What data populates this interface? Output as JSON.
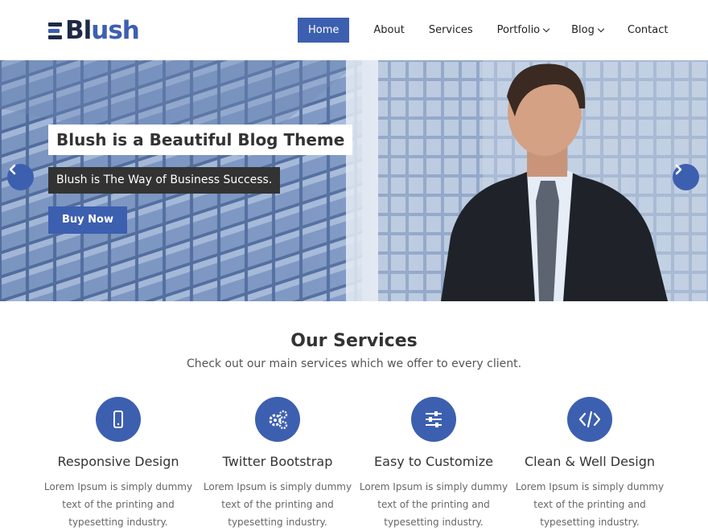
{
  "logo": {
    "part1": "Bl",
    "part2": "ush"
  },
  "nav": {
    "home": "Home",
    "about": "About",
    "services": "Services",
    "portfolio": "Portfolio",
    "blog": "Blog",
    "contact": "Contact"
  },
  "hero": {
    "title": "Blush is a Beautiful Blog Theme",
    "subtitle": "Blush is The Way of Business Success.",
    "button": "Buy Now"
  },
  "services": {
    "title": "Our Services",
    "subtitle": "Check out our main services which we offer to every client.",
    "items": [
      {
        "icon": "mobile-icon",
        "title": "Responsive Design",
        "text": "Lorem Ipsum is simply dummy text of the printing and typesetting industry."
      },
      {
        "icon": "gears-icon",
        "title": "Twitter Bootstrap",
        "text": "Lorem Ipsum is simply dummy text of the printing and typesetting industry."
      },
      {
        "icon": "sliders-icon",
        "title": "Easy to Customize",
        "text": "Lorem Ipsum is simply dummy text of the printing and typesetting industry."
      },
      {
        "icon": "code-icon",
        "title": "Clean & Well Design",
        "text": "Lorem Ipsum is simply dummy text of the printing and typesetting industry."
      }
    ]
  },
  "colors": {
    "accent": "#3d5fb0",
    "dark": "#333333",
    "logo_dark": "#1e2a44"
  }
}
